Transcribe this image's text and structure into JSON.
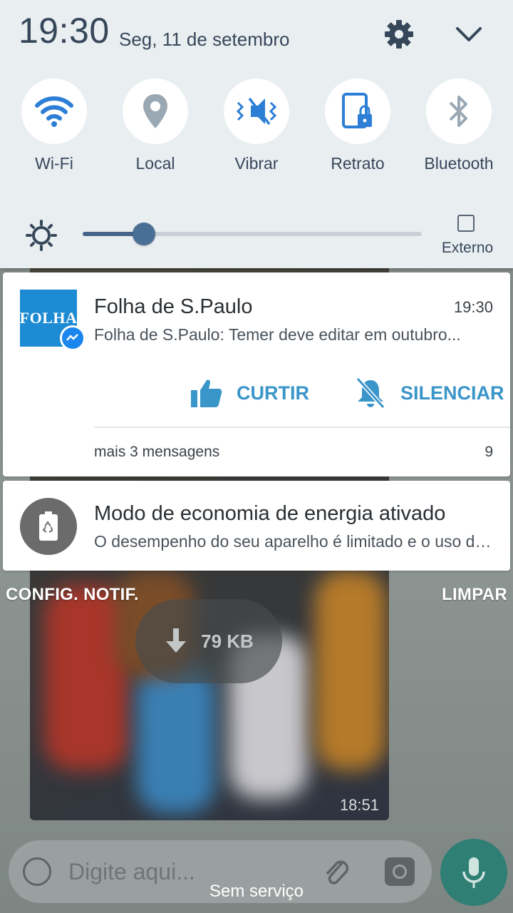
{
  "status": {
    "time": "19:30",
    "date": "Seg, 11 de setembro"
  },
  "quick_settings": [
    {
      "label": "Wi-Fi",
      "icon": "wifi-icon",
      "active": true
    },
    {
      "label": "Local",
      "icon": "location-icon",
      "active": false
    },
    {
      "label": "Vibrar",
      "icon": "vibrate-icon",
      "active": true
    },
    {
      "label": "Retrato",
      "icon": "portrait-lock-icon",
      "active": true
    },
    {
      "label": "Bluetooth",
      "icon": "bluetooth-icon",
      "active": false
    }
  ],
  "brightness": {
    "level": 0.18,
    "icon": "brightness-icon"
  },
  "external": {
    "label": "Externo",
    "checked": false
  },
  "notifications": [
    {
      "app_logo_text": "FOLHA",
      "title": "Folha de S.Paulo",
      "time": "19:30",
      "text": "Folha de S.Paulo: Temer deve editar em outubro...",
      "actions": [
        {
          "label": "CURTIR",
          "icon": "thumbs-up-icon"
        },
        {
          "label": "SILENCIAR",
          "icon": "bell-off-icon"
        }
      ],
      "more_label": "mais 3 mensagens",
      "more_count": "9"
    },
    {
      "title": "Modo de economia de energia ativado",
      "text": "O desempenho do seu aparelho é limitado e o uso de dados...",
      "icon": "battery-saver-icon"
    }
  ],
  "footer": {
    "settings_label": "CONFIG. NOTIF.",
    "clear_label": "LIMPAR"
  },
  "background_chat": {
    "download_size": "79 KB",
    "image_time": "18:51",
    "input_placeholder": "Digite aqui...",
    "network_status": "Sem serviço"
  },
  "colors": {
    "accent": "#3a95c9",
    "panel_bg": "#e9eef1",
    "icon_blue": "#2d7fd6",
    "icon_gray": "#9aa8b4",
    "fab": "#2f7f74"
  }
}
